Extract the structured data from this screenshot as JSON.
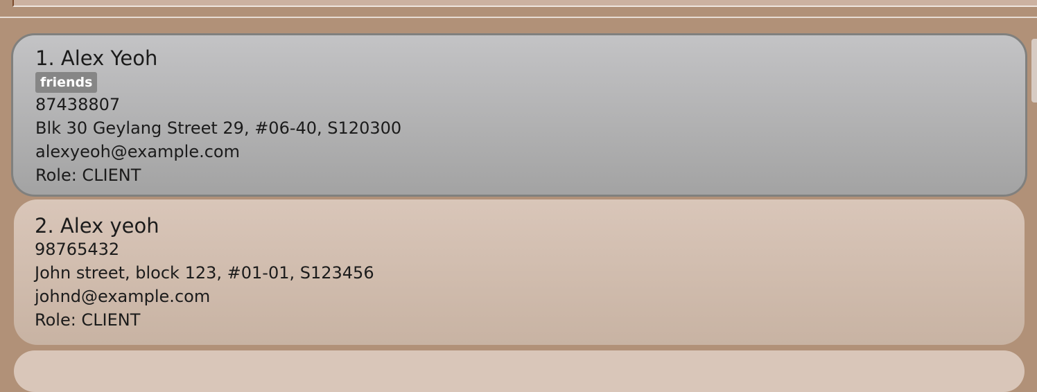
{
  "persons": [
    {
      "name": "1. Alex Yeoh",
      "tags": [
        "friends"
      ],
      "phone": "87438807",
      "address": "Blk 30 Geylang Street 29, #06-40, S120300",
      "email": "alexyeoh@example.com",
      "role": "Role: CLIENT"
    },
    {
      "name": "2. Alex yeoh",
      "tags": [],
      "phone": "98765432",
      "address": "John street, block 123, #01-01, S123456",
      "email": "johnd@example.com",
      "role": "Role: CLIENT"
    }
  ],
  "colors": {
    "background": "#b19178",
    "selected_card": "#b4b4b5",
    "card": "#d2bfb1",
    "tag": "#868686"
  }
}
